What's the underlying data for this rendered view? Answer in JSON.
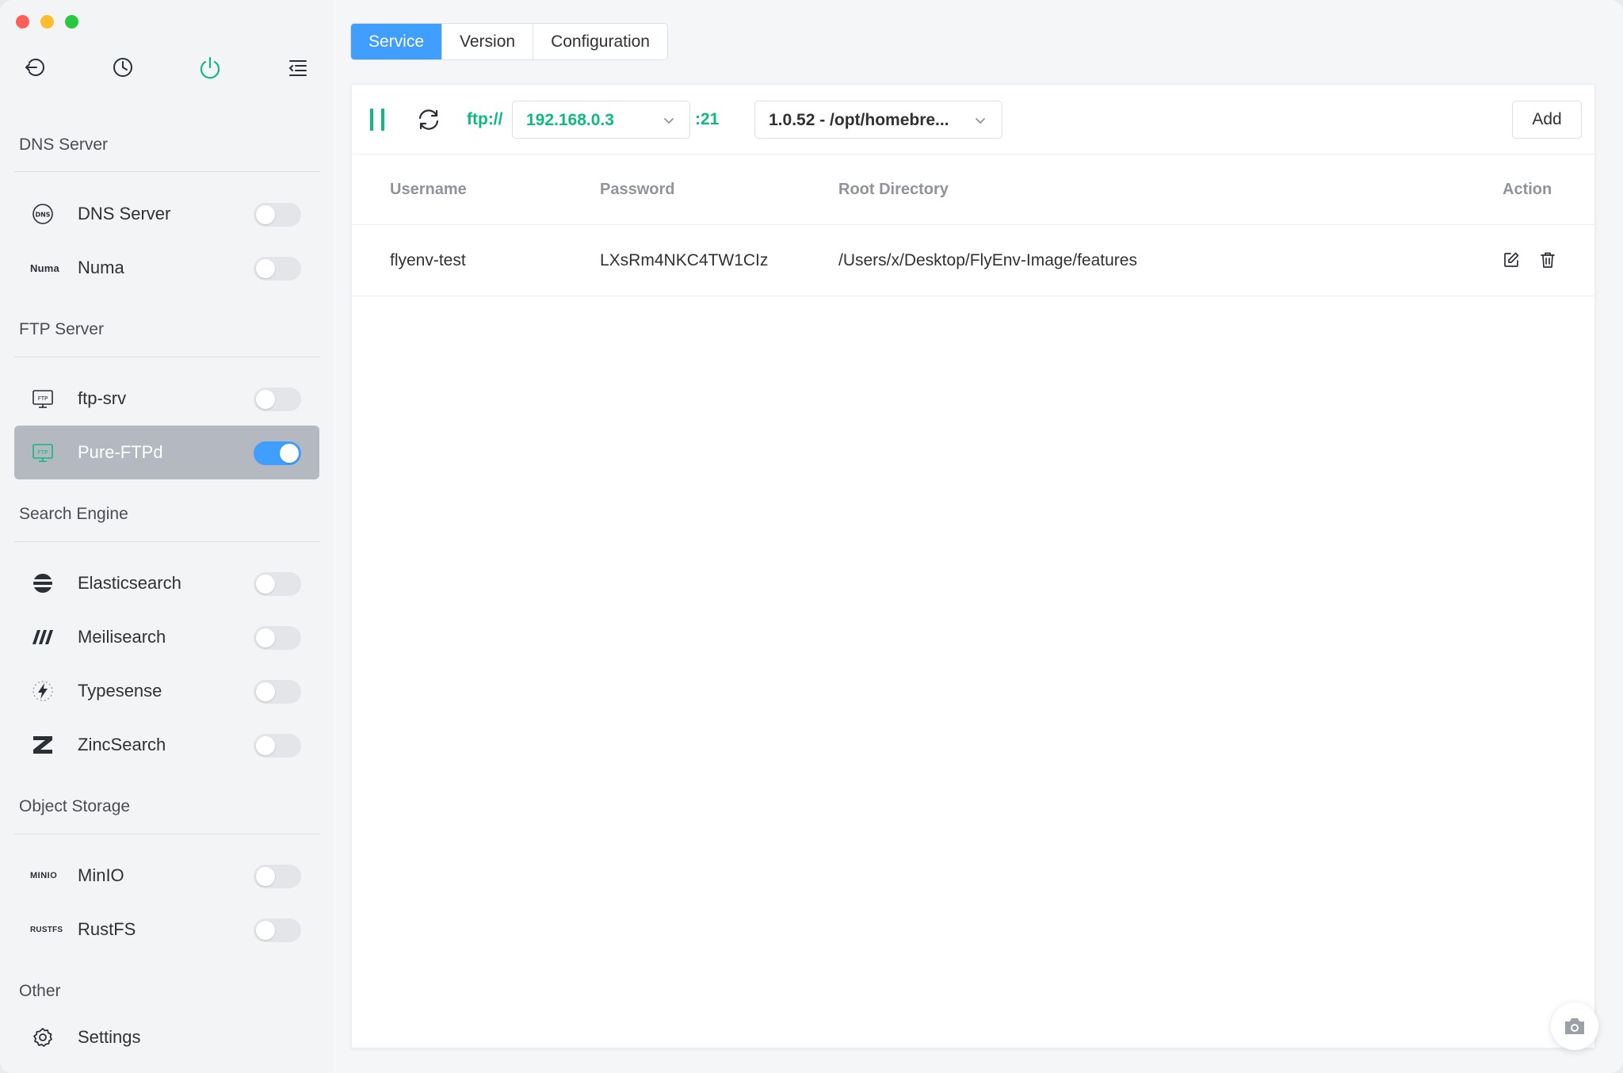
{
  "window": {
    "traffic_lights": [
      "close",
      "minimize",
      "maximize"
    ]
  },
  "sidebar": {
    "top_icons": [
      "back-icon",
      "history-icon",
      "power-icon",
      "menu-collapse-icon"
    ],
    "sections": [
      {
        "title": "DNS Server",
        "items": [
          {
            "label": "DNS Server",
            "icon": "dns-icon",
            "enabled": false
          },
          {
            "label": "Numa",
            "icon": "numa-logo",
            "logo_text": "Numa",
            "enabled": false
          }
        ]
      },
      {
        "title": "FTP Server",
        "items": [
          {
            "label": "ftp-srv",
            "icon": "ftp-icon",
            "enabled": false
          },
          {
            "label": "Pure-FTPd",
            "icon": "ftp-icon",
            "enabled": true,
            "active": true
          }
        ]
      },
      {
        "title": "Search Engine",
        "items": [
          {
            "label": "Elasticsearch",
            "icon": "elasticsearch-icon",
            "enabled": false
          },
          {
            "label": "Meilisearch",
            "icon": "meilisearch-icon",
            "enabled": false
          },
          {
            "label": "Typesense",
            "icon": "typesense-icon",
            "enabled": false
          },
          {
            "label": "ZincSearch",
            "icon": "zincsearch-icon",
            "enabled": false
          }
        ]
      },
      {
        "title": "Object Storage",
        "items": [
          {
            "label": "MinIO",
            "icon": "minio-logo",
            "logo_text": "MINIO",
            "enabled": false
          },
          {
            "label": "RustFS",
            "icon": "rustfs-logo",
            "logo_text": "RUSTFS",
            "enabled": false
          }
        ]
      },
      {
        "title": "Other",
        "items": [
          {
            "label": "Settings",
            "icon": "gear-icon"
          }
        ]
      }
    ]
  },
  "tabs": [
    {
      "label": "Service",
      "active": true
    },
    {
      "label": "Version",
      "active": false
    },
    {
      "label": "Configuration",
      "active": false
    }
  ],
  "toolbar": {
    "protocol": "ftp://",
    "ip": "192.168.0.3",
    "port": ":21",
    "version": "1.0.52 - /opt/homebre...",
    "add_label": "Add"
  },
  "table": {
    "headers": {
      "username": "Username",
      "password": "Password",
      "root": "Root Directory",
      "action": "Action"
    },
    "rows": [
      {
        "username": "flyenv-test",
        "password": "LXsRm4NKC4TW1CIz",
        "root": "/Users/x/Desktop/FlyEnv-Image/features"
      }
    ]
  },
  "colors": {
    "accent": "#409eff",
    "green": "#10b981",
    "active_item": "#b3b8c1"
  }
}
